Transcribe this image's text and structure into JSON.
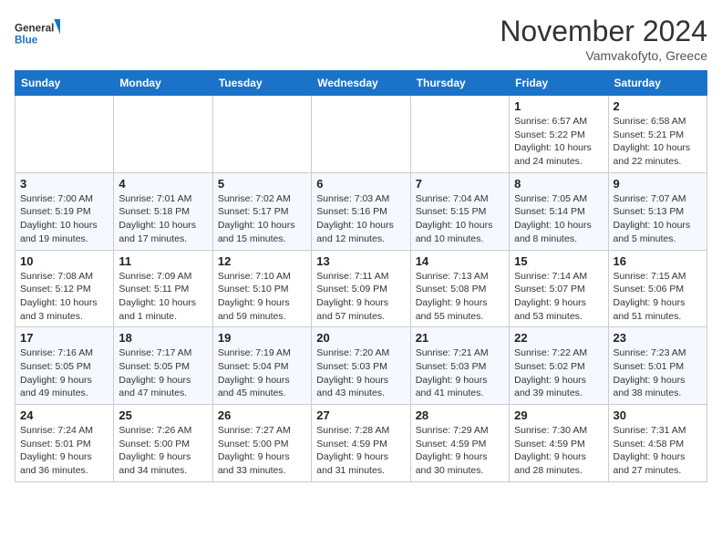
{
  "header": {
    "logo_general": "General",
    "logo_blue": "Blue",
    "month_title": "November 2024",
    "subtitle": "Vamvakofyto, Greece"
  },
  "days_of_week": [
    "Sunday",
    "Monday",
    "Tuesday",
    "Wednesday",
    "Thursday",
    "Friday",
    "Saturday"
  ],
  "weeks": [
    [
      {
        "day": "",
        "info": ""
      },
      {
        "day": "",
        "info": ""
      },
      {
        "day": "",
        "info": ""
      },
      {
        "day": "",
        "info": ""
      },
      {
        "day": "",
        "info": ""
      },
      {
        "day": "1",
        "info": "Sunrise: 6:57 AM\nSunset: 5:22 PM\nDaylight: 10 hours and 24 minutes."
      },
      {
        "day": "2",
        "info": "Sunrise: 6:58 AM\nSunset: 5:21 PM\nDaylight: 10 hours and 22 minutes."
      }
    ],
    [
      {
        "day": "3",
        "info": "Sunrise: 7:00 AM\nSunset: 5:19 PM\nDaylight: 10 hours and 19 minutes."
      },
      {
        "day": "4",
        "info": "Sunrise: 7:01 AM\nSunset: 5:18 PM\nDaylight: 10 hours and 17 minutes."
      },
      {
        "day": "5",
        "info": "Sunrise: 7:02 AM\nSunset: 5:17 PM\nDaylight: 10 hours and 15 minutes."
      },
      {
        "day": "6",
        "info": "Sunrise: 7:03 AM\nSunset: 5:16 PM\nDaylight: 10 hours and 12 minutes."
      },
      {
        "day": "7",
        "info": "Sunrise: 7:04 AM\nSunset: 5:15 PM\nDaylight: 10 hours and 10 minutes."
      },
      {
        "day": "8",
        "info": "Sunrise: 7:05 AM\nSunset: 5:14 PM\nDaylight: 10 hours and 8 minutes."
      },
      {
        "day": "9",
        "info": "Sunrise: 7:07 AM\nSunset: 5:13 PM\nDaylight: 10 hours and 5 minutes."
      }
    ],
    [
      {
        "day": "10",
        "info": "Sunrise: 7:08 AM\nSunset: 5:12 PM\nDaylight: 10 hours and 3 minutes."
      },
      {
        "day": "11",
        "info": "Sunrise: 7:09 AM\nSunset: 5:11 PM\nDaylight: 10 hours and 1 minute."
      },
      {
        "day": "12",
        "info": "Sunrise: 7:10 AM\nSunset: 5:10 PM\nDaylight: 9 hours and 59 minutes."
      },
      {
        "day": "13",
        "info": "Sunrise: 7:11 AM\nSunset: 5:09 PM\nDaylight: 9 hours and 57 minutes."
      },
      {
        "day": "14",
        "info": "Sunrise: 7:13 AM\nSunset: 5:08 PM\nDaylight: 9 hours and 55 minutes."
      },
      {
        "day": "15",
        "info": "Sunrise: 7:14 AM\nSunset: 5:07 PM\nDaylight: 9 hours and 53 minutes."
      },
      {
        "day": "16",
        "info": "Sunrise: 7:15 AM\nSunset: 5:06 PM\nDaylight: 9 hours and 51 minutes."
      }
    ],
    [
      {
        "day": "17",
        "info": "Sunrise: 7:16 AM\nSunset: 5:05 PM\nDaylight: 9 hours and 49 minutes."
      },
      {
        "day": "18",
        "info": "Sunrise: 7:17 AM\nSunset: 5:05 PM\nDaylight: 9 hours and 47 minutes."
      },
      {
        "day": "19",
        "info": "Sunrise: 7:19 AM\nSunset: 5:04 PM\nDaylight: 9 hours and 45 minutes."
      },
      {
        "day": "20",
        "info": "Sunrise: 7:20 AM\nSunset: 5:03 PM\nDaylight: 9 hours and 43 minutes."
      },
      {
        "day": "21",
        "info": "Sunrise: 7:21 AM\nSunset: 5:03 PM\nDaylight: 9 hours and 41 minutes."
      },
      {
        "day": "22",
        "info": "Sunrise: 7:22 AM\nSunset: 5:02 PM\nDaylight: 9 hours and 39 minutes."
      },
      {
        "day": "23",
        "info": "Sunrise: 7:23 AM\nSunset: 5:01 PM\nDaylight: 9 hours and 38 minutes."
      }
    ],
    [
      {
        "day": "24",
        "info": "Sunrise: 7:24 AM\nSunset: 5:01 PM\nDaylight: 9 hours and 36 minutes."
      },
      {
        "day": "25",
        "info": "Sunrise: 7:26 AM\nSunset: 5:00 PM\nDaylight: 9 hours and 34 minutes."
      },
      {
        "day": "26",
        "info": "Sunrise: 7:27 AM\nSunset: 5:00 PM\nDaylight: 9 hours and 33 minutes."
      },
      {
        "day": "27",
        "info": "Sunrise: 7:28 AM\nSunset: 4:59 PM\nDaylight: 9 hours and 31 minutes."
      },
      {
        "day": "28",
        "info": "Sunrise: 7:29 AM\nSunset: 4:59 PM\nDaylight: 9 hours and 30 minutes."
      },
      {
        "day": "29",
        "info": "Sunrise: 7:30 AM\nSunset: 4:59 PM\nDaylight: 9 hours and 28 minutes."
      },
      {
        "day": "30",
        "info": "Sunrise: 7:31 AM\nSunset: 4:58 PM\nDaylight: 9 hours and 27 minutes."
      }
    ]
  ]
}
